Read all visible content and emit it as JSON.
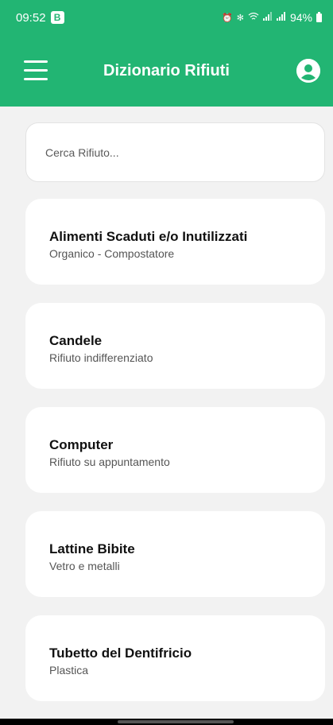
{
  "status_bar": {
    "time": "09:52",
    "badge": "B",
    "icons": [
      "alarm-icon",
      "bluetooth-icon",
      "wifi-icon",
      "signal-icon",
      "signal-icon",
      "battery-icon"
    ],
    "battery": "94%"
  },
  "app_bar": {
    "title": "Dizionario Rifiuti",
    "menu_icon": "hamburger-menu-icon",
    "profile_icon": "user-avatar-icon"
  },
  "search": {
    "value": "",
    "placeholder": "Cerca Rifiuto..."
  },
  "items": [
    {
      "title": "Alimenti Scaduti e/o Inutilizzati",
      "category": "Organico - Compostatore"
    },
    {
      "title": "Candele",
      "category": "Rifiuto indifferenziato"
    },
    {
      "title": "Computer",
      "category": "Rifiuto su appuntamento"
    },
    {
      "title": "Lattine Bibite",
      "category": "Vetro e metalli"
    },
    {
      "title": "Tubetto del Dentifricio",
      "category": "Plastica"
    }
  ],
  "colors": {
    "primary": "#22b573",
    "background": "#f2f2f2",
    "card": "#ffffff"
  }
}
